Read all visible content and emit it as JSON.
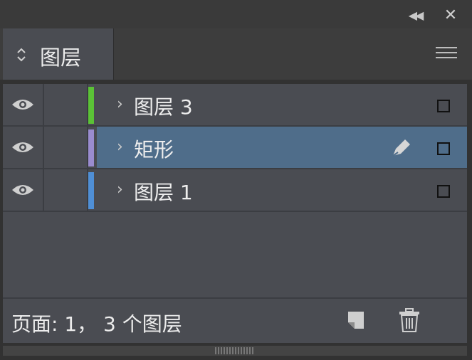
{
  "panel": {
    "tab_label": "图层",
    "icons": {
      "collapse": "double-chevron-left-icon",
      "close": "close-icon",
      "tab_arrows": "up-down-arrows-icon",
      "menu": "hamburger-menu-icon",
      "eye": "eye-icon",
      "chevron": "chevron-right-icon",
      "pen": "pen-icon",
      "new_layer": "new-layer-icon",
      "trash": "trash-icon"
    }
  },
  "layers": [
    {
      "name": "图层 3",
      "color": "#5bc236",
      "selected": false,
      "chevron": "›"
    },
    {
      "name": "矩形",
      "color": "#9a8ccf",
      "selected": true,
      "chevron": "›"
    },
    {
      "name": "图层 1",
      "color": "#4f8fd6",
      "selected": false,
      "chevron": "›"
    }
  ],
  "footer": {
    "status": "页面: 1， 3 个图层"
  }
}
